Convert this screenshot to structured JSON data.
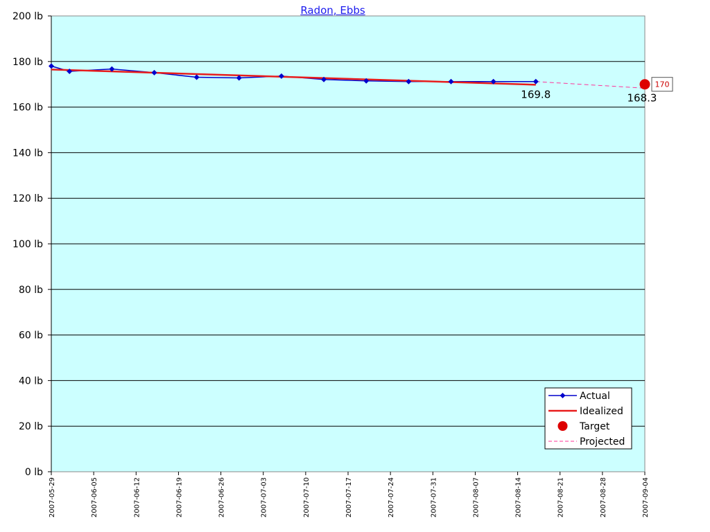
{
  "chart_data": {
    "type": "line",
    "title": "Radon, Ebbs",
    "xlabel": "",
    "ylabel": "",
    "y_unit": "lb",
    "ylim": [
      0,
      200
    ],
    "yticks": [
      0,
      20,
      40,
      60,
      80,
      100,
      120,
      140,
      160,
      180,
      200
    ],
    "xlim": [
      "2007-05-29",
      "2007-09-04"
    ],
    "xticks": [
      "2007-05-29",
      "2007-06-05",
      "2007-06-12",
      "2007-06-19",
      "2007-06-26",
      "2007-07-03",
      "2007-07-10",
      "2007-07-17",
      "2007-07-24",
      "2007-07-31",
      "2007-08-07",
      "2007-08-14",
      "2007-08-21",
      "2007-08-28",
      "2007-09-04"
    ],
    "grid": "horizontal",
    "legend_position": "bottom-right",
    "colors": {
      "plot_background": "#ccffff",
      "actual": "#0000cc",
      "idealized": "#e81c1c",
      "target": "#dd0000",
      "projected": "#ff3399"
    },
    "series": [
      {
        "name": "Actual",
        "style": "line-diamond",
        "x": [
          "2007-05-29",
          "2007-06-01",
          "2007-06-08",
          "2007-06-15",
          "2007-06-22",
          "2007-06-29",
          "2007-07-06",
          "2007-07-13",
          "2007-07-20",
          "2007-07-27",
          "2007-08-03",
          "2007-08-10",
          "2007-08-17"
        ],
        "y": [
          178.0,
          175.7,
          176.7,
          175.1,
          173.1,
          172.8,
          173.6,
          172.1,
          171.5,
          171.2,
          171.2,
          171.2,
          171.2
        ]
      },
      {
        "name": "Idealized",
        "style": "thick-line",
        "x": [
          "2007-05-29",
          "2007-08-17"
        ],
        "y": [
          176.5,
          169.8
        ]
      },
      {
        "name": "Target",
        "style": "dot",
        "x": [
          "2007-09-04"
        ],
        "y": [
          170
        ]
      },
      {
        "name": "Projected",
        "style": "dashed",
        "x": [
          "2007-08-17",
          "2007-09-04"
        ],
        "y": [
          171.2,
          168.3
        ]
      }
    ],
    "annotations": [
      {
        "text": "169.8",
        "x": "2007-08-17",
        "y": 169.8
      },
      {
        "text": "168.3",
        "x": "2007-09-04",
        "y": 168.3
      }
    ],
    "target_label": "170",
    "legend": [
      "Actual",
      "Idealized",
      "Target",
      "Projected"
    ]
  }
}
